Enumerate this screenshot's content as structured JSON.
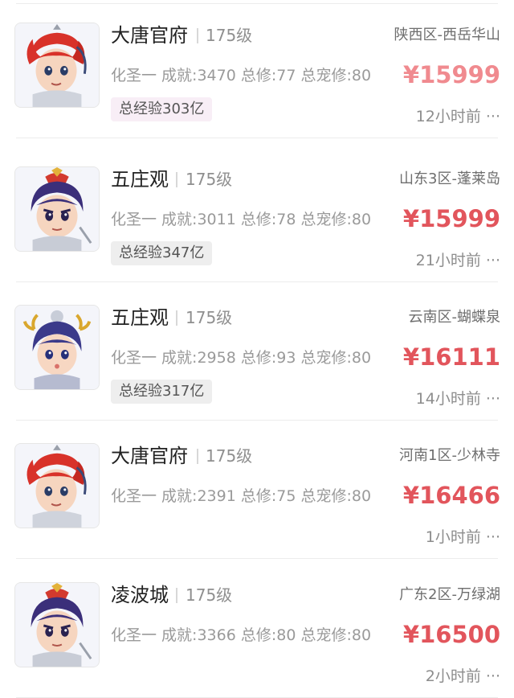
{
  "listings": [
    {
      "faction": "大唐官府",
      "level": "175级",
      "server": "陕西区-西岳华山",
      "stats": "化圣一 成就:3470 总修:77 总宠修:80",
      "price": "¥15999",
      "badge": "总经验303亿",
      "time": "12小时前 ···",
      "avatar_icon": "red-hair-warrior-avatar",
      "price_color": "#f08a8f",
      "badge_bg": "#f8eef6"
    },
    {
      "faction": "五庄观",
      "level": "175级",
      "server": "山东3区-蓬莱岛",
      "stats": "化圣一 成就:3011 总修:78 总宠修:80",
      "price": "¥15999",
      "badge": "总经验347亿",
      "time": "21小时前 ···",
      "avatar_icon": "purple-hair-warrior-avatar",
      "price_color": "#e2555c",
      "badge_bg": "#eeeeee"
    },
    {
      "faction": "五庄观",
      "level": "175级",
      "server": "云南区-蝴蝶泉",
      "stats": "化圣一 成就:2958 总修:93 总宠修:80",
      "price": "¥16111",
      "badge": "总经验317亿",
      "time": "14小时前 ···",
      "avatar_icon": "child-warrior-avatar",
      "price_color": "#e2555c",
      "badge_bg": "#eeeeee"
    },
    {
      "faction": "大唐官府",
      "level": "175级",
      "server": "河南1区-少林寺",
      "stats": "化圣一 成就:2391 总修:75 总宠修:80",
      "price": "¥16466",
      "badge": "",
      "time": "1小时前 ···",
      "avatar_icon": "red-hair-warrior-avatar",
      "price_color": "#e2555c",
      "badge_bg": "#eeeeee"
    },
    {
      "faction": "凌波城",
      "level": "175级",
      "server": "广东2区-万绿湖",
      "stats": "化圣一 成就:3366 总修:80 总宠修:80",
      "price": "¥16500",
      "badge": "",
      "time": "2小时前 ···",
      "avatar_icon": "purple-hair-warrior-avatar",
      "price_color": "#e2555c",
      "badge_bg": "#eeeeee"
    }
  ]
}
